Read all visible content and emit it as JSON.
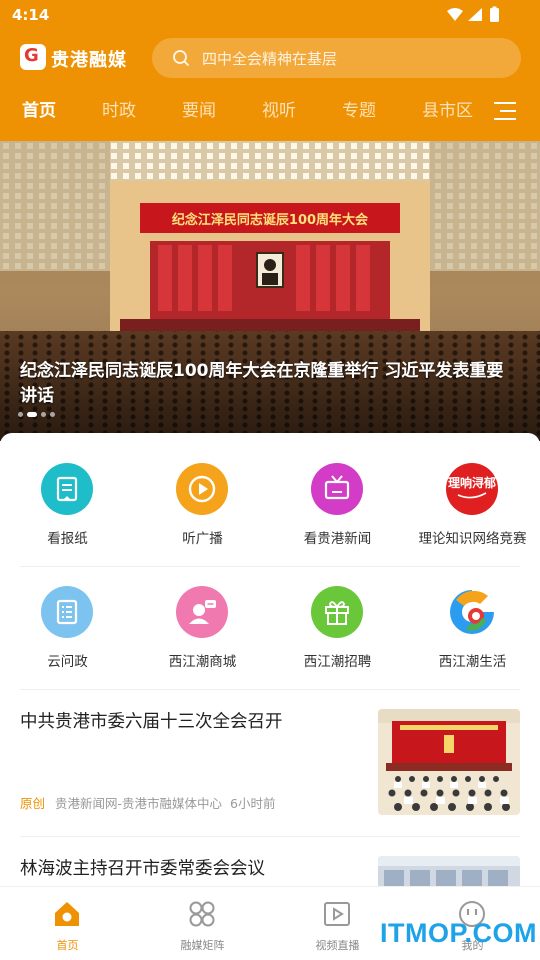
{
  "status_bar": {
    "time": "4:14"
  },
  "app": {
    "logo_text": "贵港融媒",
    "logo_mark": "G"
  },
  "search": {
    "placeholder": "四中全会精神在基层"
  },
  "tabs": [
    {
      "label": "首页",
      "active": true
    },
    {
      "label": "时政"
    },
    {
      "label": "要闻"
    },
    {
      "label": "视听"
    },
    {
      "label": "专题"
    },
    {
      "label": "县市区"
    }
  ],
  "banner": {
    "title": "纪念江泽民同志诞辰100周年大会在京隆重举行 习近平发表重要讲话",
    "stage_banner_text": "纪念江泽民同志诞辰100周年大会",
    "slide_count": 4,
    "active_slide": 1
  },
  "grid": [
    {
      "label": "看报纸",
      "icon": "newspaper-icon",
      "color": "#1FBDC9"
    },
    {
      "label": "听广播",
      "icon": "play-radio-icon",
      "color": "#F5A31A"
    },
    {
      "label": "看贵港新闻",
      "icon": "tv-icon",
      "color": "#D33CC6"
    },
    {
      "label": "理论知识网络竞赛",
      "icon": "theory-quiz-logo-icon",
      "color": "#E02020",
      "logo_text": "理响浔郁"
    },
    {
      "label": "云问政",
      "icon": "document-list-icon",
      "color": "#7DC3F0"
    },
    {
      "label": "西江潮商城",
      "icon": "shop-assistant-icon",
      "color": "#F07AB0"
    },
    {
      "label": "西江潮招聘",
      "icon": "gift-box-icon",
      "color": "#6BC73A"
    },
    {
      "label": "西江潮生活",
      "icon": "xijiangchao-swirl-icon",
      "color": "#2C9CF0"
    }
  ],
  "news": [
    {
      "title": "中共贵港市委六届十三次全会召开",
      "tag": "原创",
      "source": "贵港新闻网-贵港市融媒体中心",
      "time": "6小时前"
    },
    {
      "title": "林海波主持召开市委常委会会议"
    }
  ],
  "bottom_nav": [
    {
      "label": "首页",
      "icon": "home-icon",
      "active": true
    },
    {
      "label": "融媒矩阵",
      "icon": "matrix-grid-icon"
    },
    {
      "label": "视频直播",
      "icon": "video-live-icon"
    },
    {
      "label": "我的",
      "icon": "profile-face-icon"
    }
  ],
  "watermark": "ITMOP.COM",
  "colors": {
    "accent": "#EE9103",
    "search_bg": "#F3A93A",
    "tab_inactive": "#FCE2B8"
  }
}
